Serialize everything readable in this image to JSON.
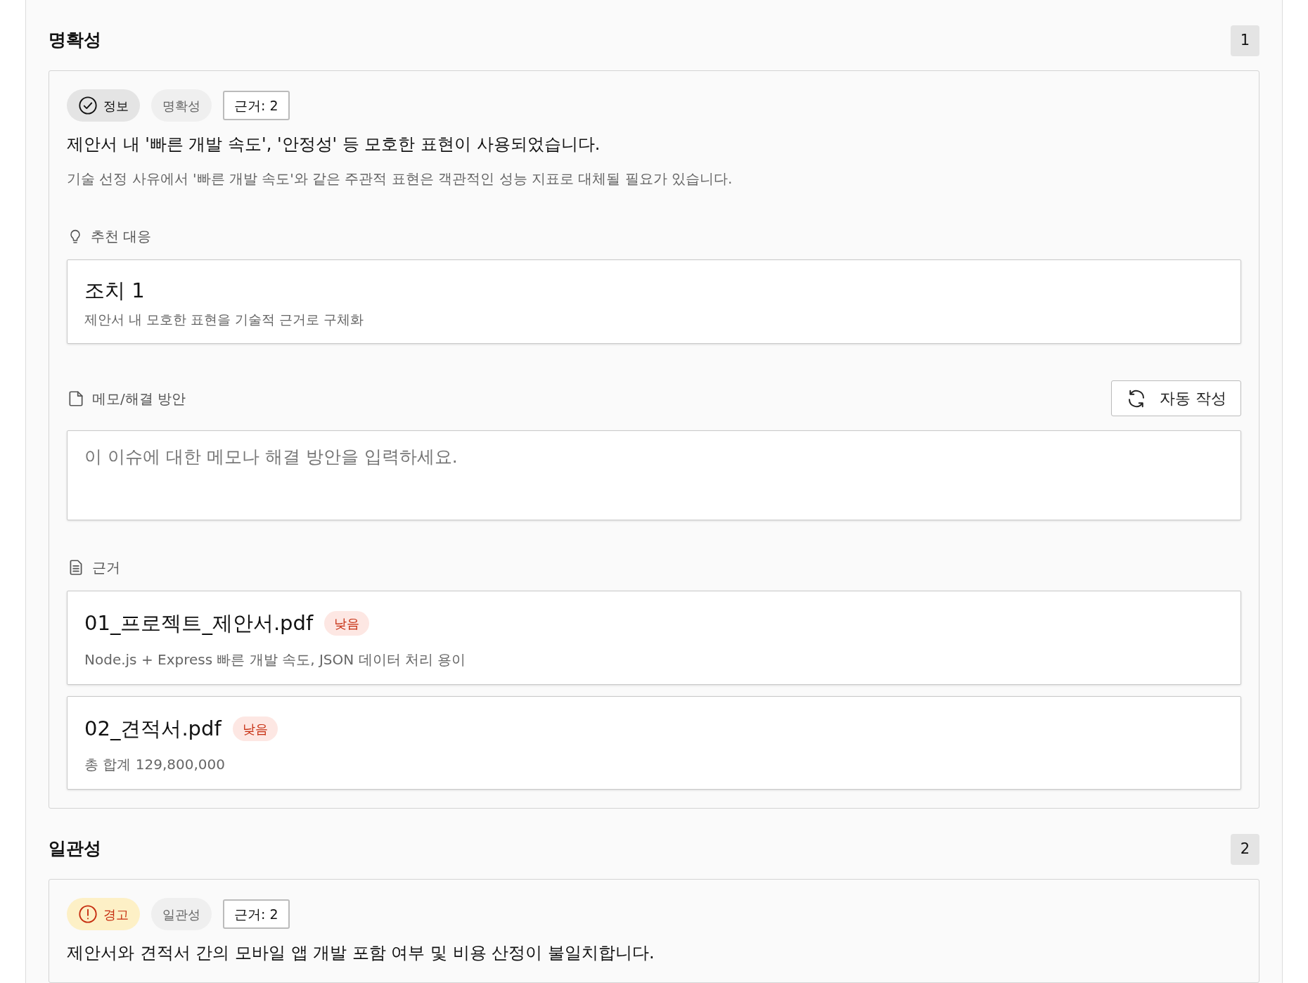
{
  "sections": [
    {
      "title": "명확성",
      "count": "1",
      "issues": [
        {
          "kind": "info",
          "severity_label": "정보",
          "category": "명확성",
          "evidence_count": "근거: 2",
          "title": "제안서 내 '빠른 개발 속도', '안정성' 등 모호한 표현이 사용되었습니다.",
          "description": "기술 선정 사유에서 '빠른 개발 속도'와 같은 주관적 표현은 객관적인 성능 지표로 대체될 필요가 있습니다.",
          "recommend_label": "추천 대응",
          "recommendations": [
            {
              "title": "조치 1",
              "detail": "제안서 내 모호한 표현을 기술적 근거로 구체화"
            }
          ],
          "memo_label": "메모/해결 방안",
          "auto_button": "자동 작성",
          "memo_placeholder": "이 이슈에 대한 메모나 해결 방안을 입력하세요.",
          "evidence_label": "근거",
          "evidence": [
            {
              "file": "01_프로젝트_제안서.pdf",
              "kind": "low",
              "relevance_label": "낮음",
              "excerpt": "Node.js + Express 빠른 개발 속도, JSON 데이터 처리 용이"
            },
            {
              "file": "02_견적서.pdf",
              "kind": "low",
              "relevance_label": "낮음",
              "excerpt": "총 합계 129,800,000"
            }
          ]
        }
      ]
    },
    {
      "title": "일관성",
      "count": "2",
      "issues": [
        {
          "kind": "warning",
          "severity_label": "경고",
          "category": "일관성",
          "evidence_count": "근거: 2",
          "title": "제안서와 견적서 간의 모바일 앱 개발 포함 여부 및 비용 산정이 불일치합니다."
        }
      ]
    }
  ]
}
